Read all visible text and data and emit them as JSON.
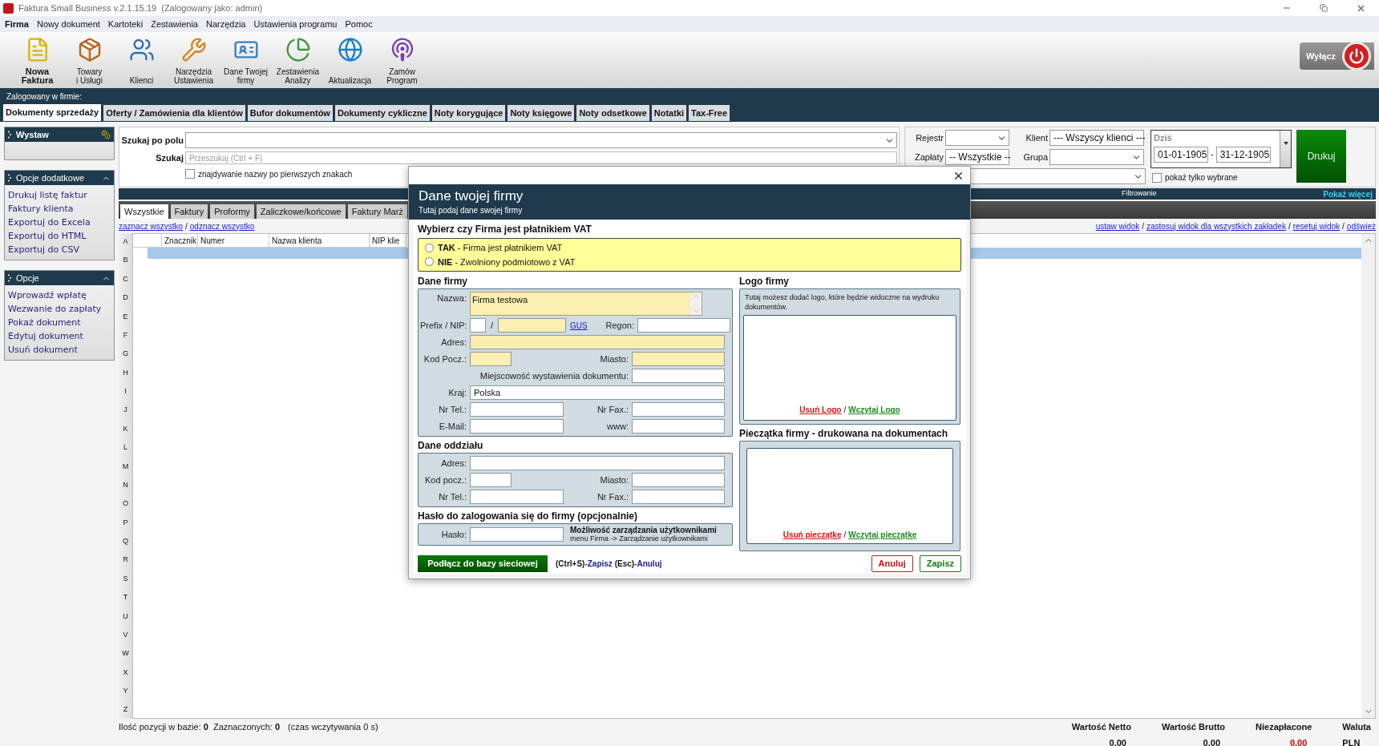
{
  "window": {
    "title": "Faktura Small Business v.2.1.15.19",
    "subtitle": "(Zalogowany jako: admin)"
  },
  "menu": [
    {
      "label": "Firma",
      "active": true
    },
    {
      "label": "Nowy dokument",
      "active": false
    },
    {
      "label": "Kartoteki",
      "active": false
    },
    {
      "label": "Zestawienia",
      "active": false
    },
    {
      "label": "Narzędzia",
      "active": false
    },
    {
      "label": "Ustawienia programu",
      "active": false
    },
    {
      "label": "Pomoc",
      "active": false
    }
  ],
  "toolbar": [
    {
      "kind": "invoice",
      "label": "Nowa\nFaktura",
      "bold": true
    },
    {
      "kind": "goods",
      "label": "Towary\ni Usługi",
      "bold": false
    },
    {
      "kind": "clients",
      "label": "Klienci",
      "bold": false
    },
    {
      "kind": "tools",
      "label": "Narzędzia\nUstawienia",
      "bold": false
    },
    {
      "kind": "company",
      "label": "Dane Twojej\nfirmy",
      "bold": false
    },
    {
      "kind": "reports",
      "label": "Zestawienia\nAnalizy",
      "bold": false
    },
    {
      "kind": "update",
      "label": "Aktualizacja",
      "bold": false
    },
    {
      "kind": "order",
      "label": "Zamów\nProgram",
      "bold": false
    }
  ],
  "power_button": {
    "label": "Wyłącz"
  },
  "company_bar": {
    "label": "Zalogowany w firmie:"
  },
  "tabs": [
    {
      "label": "Dokumenty sprzedaży",
      "selected": true
    },
    {
      "label": "Oferty / Zamówienia dla klientów",
      "selected": false
    },
    {
      "label": "Bufor dokumentów",
      "selected": false
    },
    {
      "label": "Dokumenty cykliczne",
      "selected": false
    },
    {
      "label": "Noty korygujące",
      "selected": false
    },
    {
      "label": "Noty księgowe",
      "selected": false
    },
    {
      "label": "Noty odsetkowe",
      "selected": false
    },
    {
      "label": "Notatki",
      "selected": false
    },
    {
      "label": "Tax-Free",
      "selected": false
    }
  ],
  "sidebar": [
    {
      "title": "Wystaw",
      "kind": "issue"
    },
    {
      "title": "Opcje dodatkowe",
      "kind": "list",
      "items": [
        "Drukuj listę faktur",
        "Faktury klienta",
        "Exportuj do Excela",
        "Exportuj do HTML",
        "Exportuj do CSV"
      ]
    },
    {
      "title": "Opcje",
      "kind": "list",
      "items": [
        "Wprowadź wpłatę",
        "Wezwanie do zapłaty",
        "Pokaż dokument",
        "Edytuj dokument",
        "Usuń dokument"
      ]
    }
  ],
  "search": {
    "field_label": "Szukaj po polu",
    "search_label": "Szukaj",
    "placeholder": "Przeszukaj (Ctrl + F)",
    "prefix_match": {
      "label": "znajdywanie nazwy po pierwszych znakach",
      "checked": false
    }
  },
  "filters": {
    "register_label": "Rejestr",
    "payments_label": "Zapłaty",
    "payments_value": "-- Wszystkie --",
    "client_label": "Klient",
    "client_value": "--- Wszyscy klienci ---",
    "group_label": "Grupa",
    "date_label": "Dziś",
    "date_from": "01-01-1905",
    "date_sep": "-",
    "date_to": "31-12-1905",
    "only_selected": {
      "label": "pokaż tylko wybrane",
      "checked": false
    },
    "print_button": "Drukuj",
    "bar_label": "Filtrowanie",
    "more_link": "Pokaż więcej"
  },
  "doc_tabs": [
    {
      "label": "Wszystkie",
      "selected": true
    },
    {
      "label": "Faktury",
      "selected": false
    },
    {
      "label": "Proformy",
      "selected": false
    },
    {
      "label": "Zaliczkowe/końcowe",
      "selected": false
    },
    {
      "label": "Faktury Marż",
      "selected": false
    }
  ],
  "select_links": [
    "zaznacz wszystko",
    "odznacz wszystko"
  ],
  "links_separator": "/",
  "view_links": [
    "ustaw widok",
    "zastosuj widok dla wszystkich zakładek",
    "resetuj widok",
    "odśwież"
  ],
  "table": {
    "columns": [
      "Znacznik",
      "Numer",
      "Nazwa klienta",
      "NIP klie"
    ]
  },
  "alphabet": [
    "A",
    "B",
    "C",
    "D",
    "E",
    "F",
    "G",
    "H",
    "I",
    "J",
    "K",
    "L",
    "M",
    "N",
    "O",
    "P",
    "Q",
    "R",
    "S",
    "T",
    "U",
    "V",
    "W",
    "X",
    "Y",
    "Z"
  ],
  "status": {
    "count_label": "Ilość pozycji w bazie:",
    "count": "0",
    "marked_label": "Zaznaczonych:",
    "marked": "0",
    "load_time": "(czas wczytywania 0 s)"
  },
  "totals": [
    {
      "label": "Wartość Netto",
      "value": "0,00",
      "kind": "normal"
    },
    {
      "label": "Wartość Brutto",
      "value": "0,00",
      "kind": "normal"
    },
    {
      "label": "Niezapłacone",
      "value": "0,00",
      "kind": "alert"
    },
    {
      "label": "Waluta",
      "value": "PLN",
      "kind": "normal"
    }
  ],
  "dialog": {
    "title": "Dane twojej firmy",
    "subtitle": "Tutaj podaj dane swojej firmy",
    "vat_heading": "Wybierz czy Firma jest płatnikiem VAT",
    "vat_options": [
      {
        "code": "TAK",
        "text": " - Firma jest płatnikiem VAT",
        "selected": false
      },
      {
        "code": "NIE",
        "text": " - Zwolniony podmiotowo z VAT",
        "selected": false
      }
    ],
    "company": {
      "heading": "Dane firmy",
      "name": {
        "label": "Nazwa:",
        "value": "Firma testowa",
        "required": true
      },
      "prefix": {
        "label": "Prefix / NIP:",
        "required": false
      },
      "nip_sep": "/",
      "nip": {
        "required": true
      },
      "gus_link": "GUS",
      "regon": {
        "label": "Regon:",
        "required": false
      },
      "address": {
        "label": "Adres:",
        "required": true
      },
      "postcode": {
        "label": "Kod Pocz.:",
        "required": true
      },
      "city": {
        "label": "Miasto:",
        "required": true
      },
      "issue_place": {
        "label": "Miejscowość wystawienia dokumentu:",
        "required": false
      },
      "country": {
        "label": "Kraj:",
        "value": "Polska",
        "required": false
      },
      "phone": {
        "label": "Nr Tel.:",
        "required": false
      },
      "fax": {
        "label": "Nr Fax.:",
        "required": false
      },
      "email": {
        "label": "E-Mail:",
        "required": false
      },
      "www": {
        "label": "www:",
        "required": false
      }
    },
    "branch": {
      "heading": "Dane oddziału",
      "address": "Adres:",
      "postcode": "Kod pocz.:",
      "city": "Miasto:",
      "phone": "Nr Tel.:",
      "fax": "Nr Fax.:"
    },
    "password": {
      "heading": "Hasło do zalogowania się do firmy (opcjonalnie)",
      "label": "Hasło:",
      "note_title": "Możliwość zarządzania użytkownikami",
      "note_text": "menu Firma -> Zarządzanie użytkownikami"
    },
    "logo": {
      "heading": "Logo firmy",
      "hint": "Tutaj możesz dodać logo, które będzie widoczne na wydruku dokumentów.",
      "remove": "Usuń Logo",
      "sep": "/",
      "load": "Wczytaj Logo"
    },
    "stamp": {
      "heading": "Pieczątka firmy - drukowana na dokumentach",
      "remove": "Usuń pieczątkę",
      "sep": "/",
      "load": "Wczytaj pieczątkę"
    },
    "network_button": "Podłącz do bazy sieciowej",
    "shortcuts": [
      {
        "key": "(Ctrl+S)",
        "action": "-Zapisz"
      },
      {
        "key": "(Esc)",
        "action": "-Anuluj"
      }
    ],
    "buttons": [
      {
        "label": "Anuluj",
        "kind": "cancel"
      },
      {
        "label": "Zapisz",
        "kind": "save"
      }
    ]
  }
}
